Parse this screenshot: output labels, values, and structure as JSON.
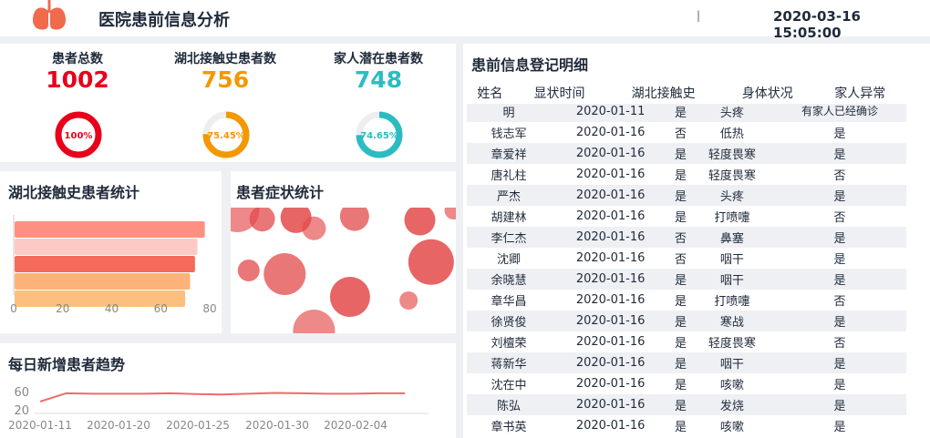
{
  "header": {
    "title": "医院患前信息分析",
    "separator": "|",
    "datetime": "2020-03-16 15:05:00"
  },
  "kpis": [
    {
      "label": "患者总数",
      "value": "1002",
      "percent_label": "100%",
      "percent": 100,
      "color": "#e8001b"
    },
    {
      "label": "湖北接触史患者数",
      "value": "756",
      "percent_label": "75.45%",
      "percent": 75.45,
      "color": "#f39800"
    },
    {
      "label": "家人潜在患者数",
      "value": "748",
      "percent_label": "74.65%",
      "percent": 74.65,
      "color": "#2bbcc2"
    }
  ],
  "panels": {
    "hubei_title": "湖北接触史患者统计",
    "symptom_title": "患者症状统计",
    "trend_title": "每日新增患者趋势",
    "table_title": "患前信息登记明细"
  },
  "table": {
    "columns": [
      "姓名",
      "显状时间",
      "湖北接触史",
      "身体状况",
      "家人异常"
    ],
    "rows": [
      [
        "明",
        "2020-01-11",
        "是",
        "头疼",
        "有家人已经确诊"
      ],
      [
        "钱志军",
        "2020-01-16",
        "否",
        "低热",
        "是"
      ],
      [
        "章爱祥",
        "2020-01-16",
        "是",
        "轻度畏寒",
        "是"
      ],
      [
        "唐礼柱",
        "2020-01-16",
        "是",
        "轻度畏寒",
        "否"
      ],
      [
        "严杰",
        "2020-01-16",
        "是",
        "头疼",
        "是"
      ],
      [
        "胡建林",
        "2020-01-16",
        "是",
        "打喷嚏",
        "否"
      ],
      [
        "李仁杰",
        "2020-01-16",
        "否",
        "鼻塞",
        "是"
      ],
      [
        "沈卿",
        "2020-01-16",
        "否",
        "咽干",
        "是"
      ],
      [
        "余晓慧",
        "2020-01-16",
        "是",
        "咽干",
        "是"
      ],
      [
        "章华昌",
        "2020-01-16",
        "是",
        "打喷嚏",
        "否"
      ],
      [
        "徐贤俊",
        "2020-01-16",
        "是",
        "寒战",
        "是"
      ],
      [
        "刘檀荣",
        "2020-01-16",
        "是",
        "轻度畏寒",
        "否"
      ],
      [
        "蒋新华",
        "2020-01-16",
        "是",
        "咽干",
        "是"
      ],
      [
        "沈在中",
        "2020-01-16",
        "是",
        "咳嗽",
        "是"
      ],
      [
        "陈弘",
        "2020-01-16",
        "是",
        "发烧",
        "是"
      ],
      [
        "章书英",
        "2020-01-16",
        "是",
        "咳嗽",
        "是"
      ]
    ]
  },
  "chart_data": [
    {
      "type": "bar",
      "orientation": "horizontal",
      "categories": [
        "",
        "",
        "",
        "",
        ""
      ],
      "values": [
        78,
        75,
        74,
        72,
        70
      ],
      "colors": [
        "#fd9082",
        "#fdc9c4",
        "#f56b59",
        "#fdb27a",
        "#fdbf7e"
      ],
      "xlim": [
        0,
        80
      ],
      "xticks": [
        "0",
        "20",
        "40",
        "60",
        "80"
      ]
    },
    {
      "type": "scatter",
      "description_type": "bubble",
      "x": [
        3,
        14,
        29,
        37,
        55,
        84,
        99,
        8,
        53,
        79,
        24,
        89,
        37
      ],
      "y": [
        100,
        93,
        94,
        85,
        95,
        92,
        100,
        50,
        28,
        25,
        47,
        57,
        0
      ],
      "size": [
        24,
        14,
        17,
        13,
        16,
        17,
        10,
        12,
        22,
        10,
        23,
        25,
        23
      ],
      "color": "#e34a4a",
      "xlim": [
        0,
        100
      ],
      "ylim": [
        0,
        100
      ]
    },
    {
      "type": "line",
      "x": [
        "2020-01-11",
        "2020-01-13",
        "2020-01-15",
        "2020-01-17",
        "2020-01-19",
        "2020-01-21",
        "2020-01-23",
        "2020-01-25",
        "2020-01-27",
        "2020-01-29",
        "2020-01-31",
        "2020-02-02",
        "2020-02-04",
        "2020-02-06",
        "2020-02-08"
      ],
      "values": [
        38,
        58,
        57,
        57,
        57,
        58,
        56,
        55,
        57,
        59,
        58,
        57,
        57,
        58,
        58
      ],
      "color": "#f06a6a",
      "yticks": [
        "60",
        "20"
      ],
      "xticks": [
        "2020-01-11",
        "2020-01-20",
        "2020-01-25",
        "2020-01-30",
        "2020-02-04"
      ]
    }
  ]
}
